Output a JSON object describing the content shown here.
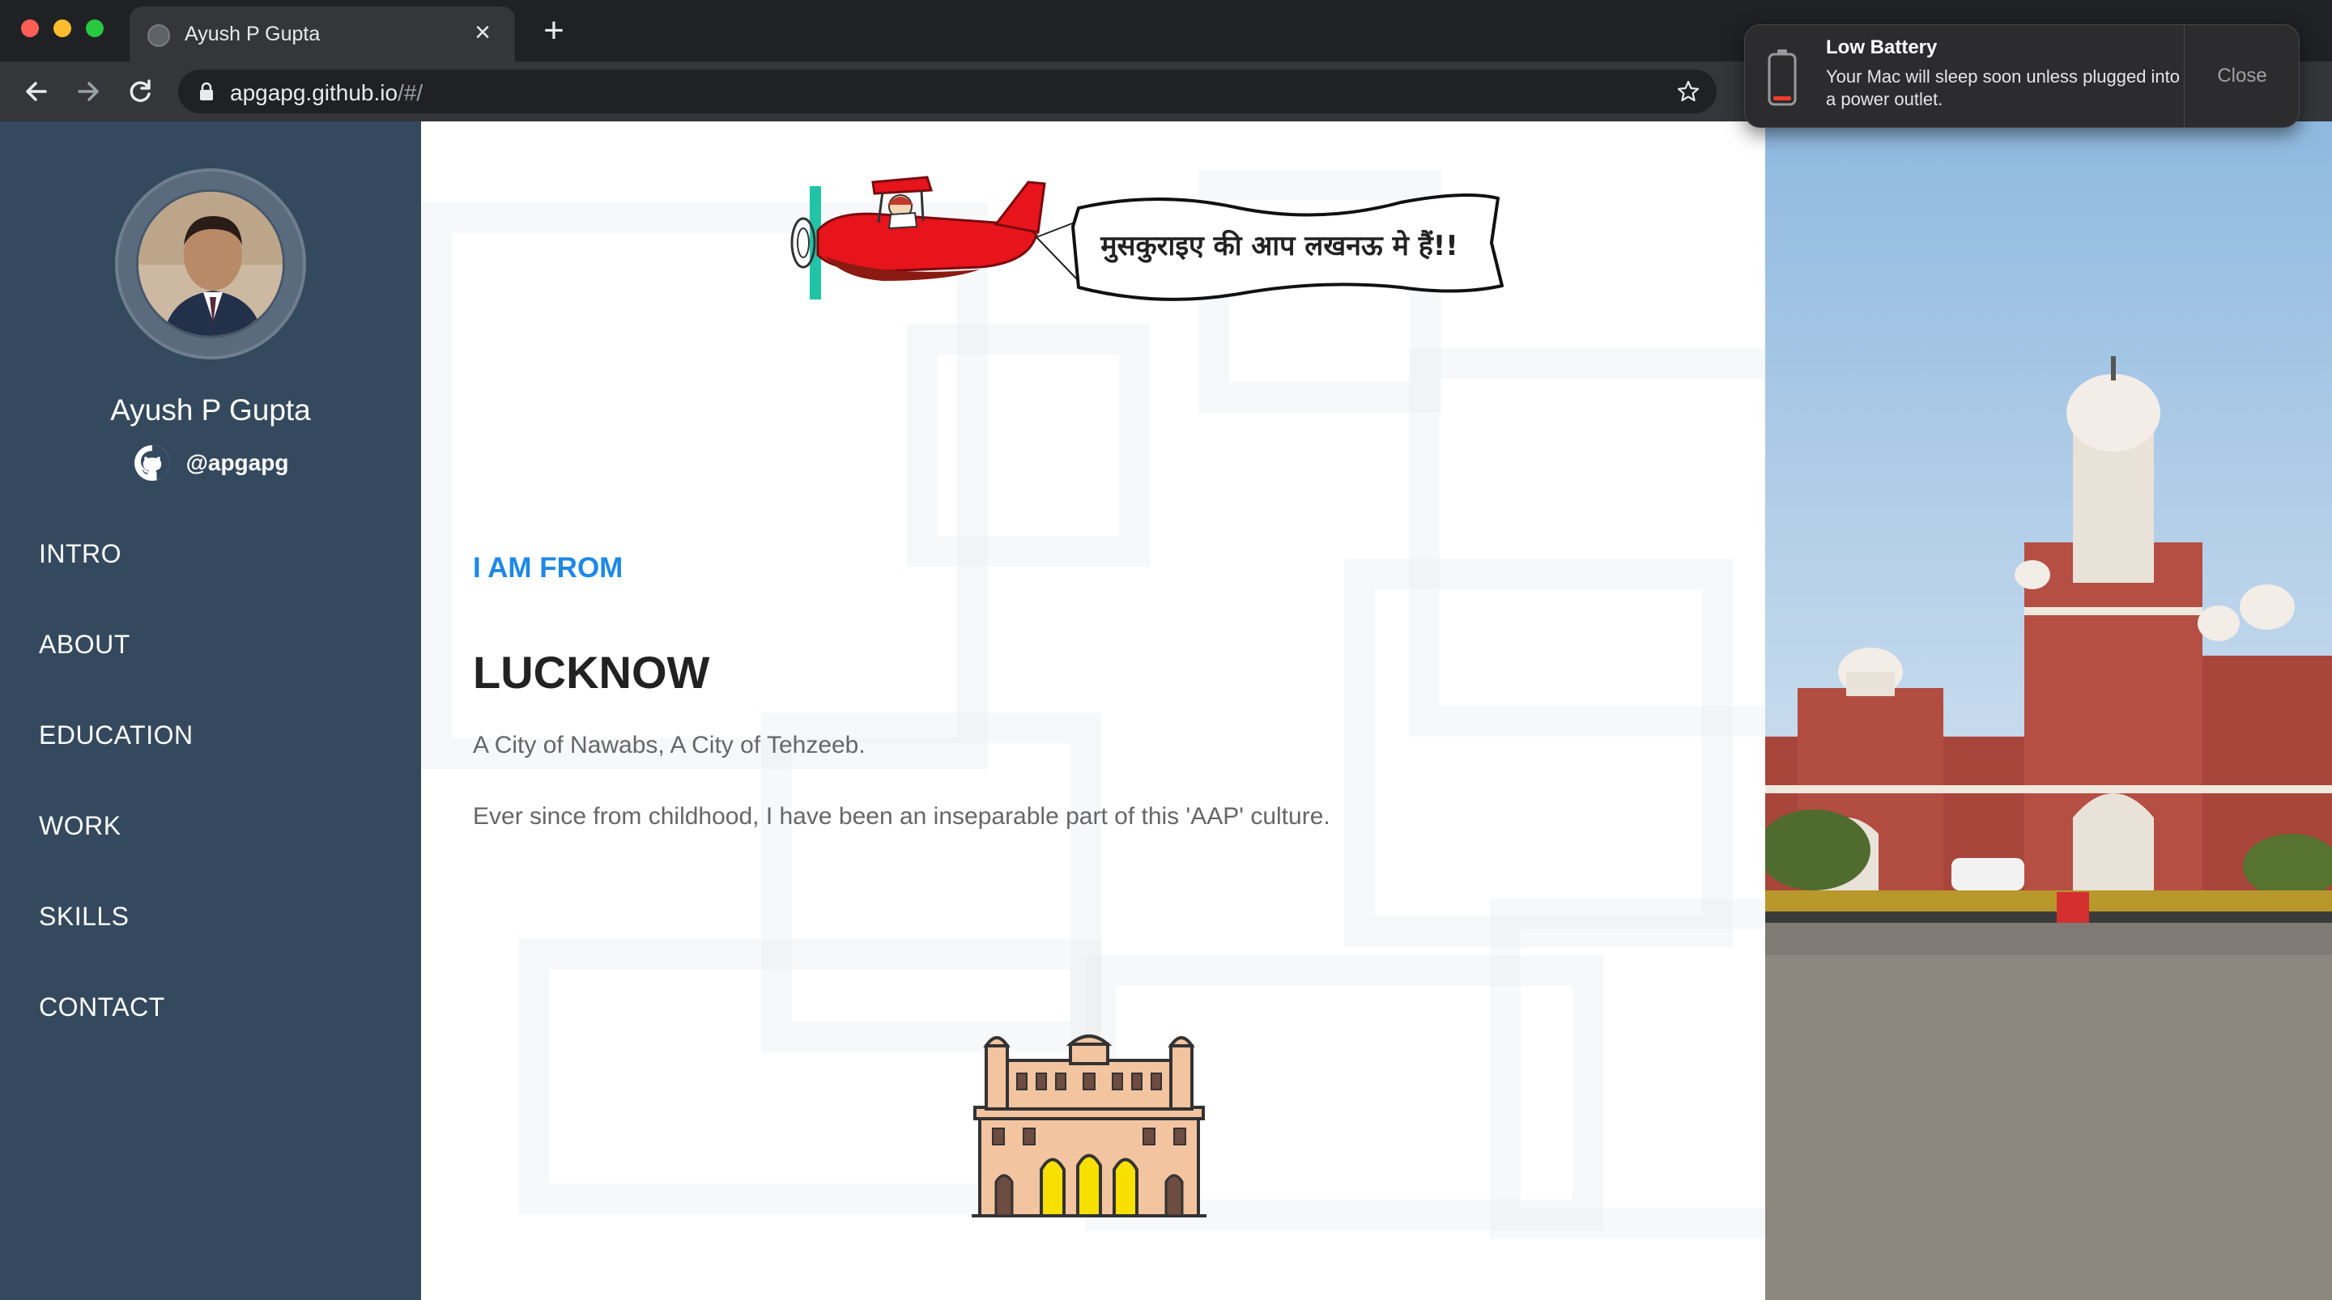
{
  "browser": {
    "tab_title": "Ayush P Gupta",
    "url_host": "apgapg.github.io",
    "url_path": "/#/"
  },
  "sidebar": {
    "name": "Ayush P Gupta",
    "github_handle": "@apgapg",
    "nav": [
      {
        "label": "INTRO"
      },
      {
        "label": "ABOUT"
      },
      {
        "label": "EDUCATION"
      },
      {
        "label": "WORK"
      },
      {
        "label": "SKILLS"
      },
      {
        "label": "CONTACT"
      }
    ]
  },
  "main": {
    "banner_text": "मुसकुराइए की आप लखनऊ मे हैं!!",
    "section_kicker": "I AM FROM",
    "city": "LUCKNOW",
    "tagline": "A City of Nawabs, A City of Tehzeeb.",
    "paragraph": "Ever since from childhood, I have been an inseparable part of this 'AAP' culture."
  },
  "notification": {
    "title": "Low Battery",
    "body": "Your Mac will sleep soon unless plugged into a power outlet.",
    "close_label": "Close"
  },
  "colors": {
    "sidebar_bg": "#34495e",
    "accent": "#1e88e5",
    "plane_red": "#e8141b"
  }
}
